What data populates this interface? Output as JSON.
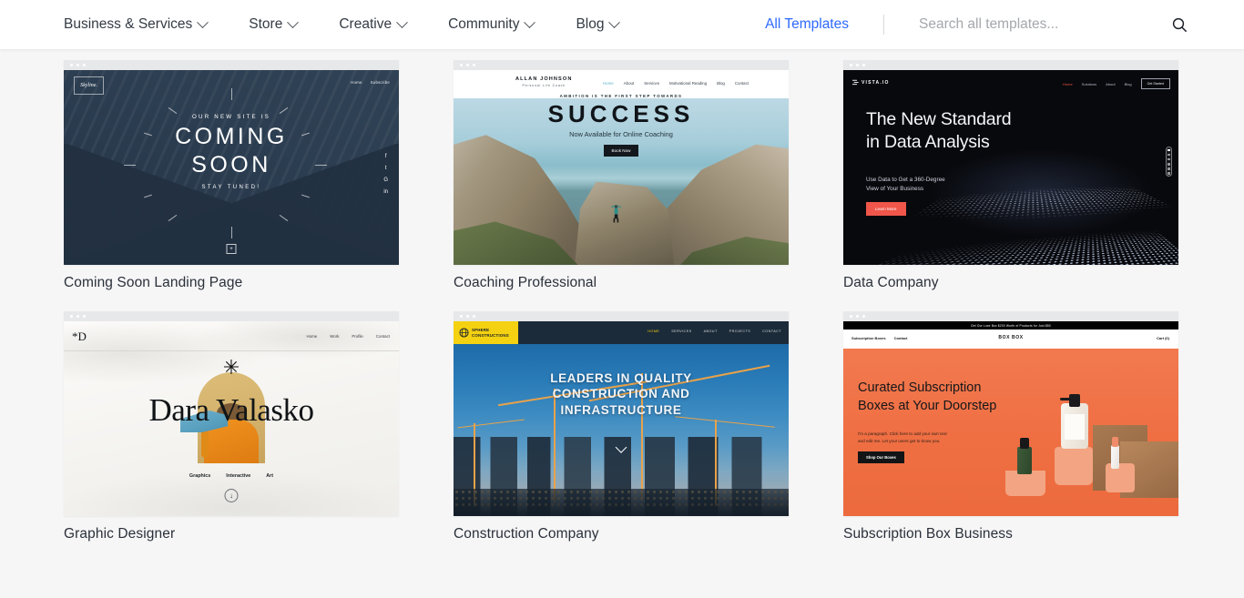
{
  "header": {
    "nav": [
      {
        "label": "Business & Services",
        "has_dropdown": true
      },
      {
        "label": "Store",
        "has_dropdown": true
      },
      {
        "label": "Creative",
        "has_dropdown": true
      },
      {
        "label": "Community",
        "has_dropdown": true
      },
      {
        "label": "Blog",
        "has_dropdown": true
      }
    ],
    "all_templates_label": "All Templates",
    "search": {
      "placeholder": "Search all templates...",
      "value": "",
      "icon": "search-icon"
    },
    "link_color": "#2e69ff"
  },
  "cards": [
    {
      "title": "Coming Soon Landing Page",
      "preview": {
        "logo": "Skyline.",
        "nav": [
          "Home",
          "Subscribe"
        ],
        "pre_heading": "OUR NEW SITE IS",
        "heading_line1": "COMING",
        "heading_line2": "SOON",
        "post_heading": "STAY TUNED!",
        "social": [
          "f",
          "t",
          "G",
          "in"
        ],
        "bg_color": "#2b3c4d"
      }
    },
    {
      "title": "Coaching Professional",
      "preview": {
        "brand_name": "ALLAN JOHNSON",
        "brand_tagline": "Personal Life Coach",
        "nav": [
          "Home",
          "About",
          "Services",
          "Motivational Reading",
          "Blog",
          "Contact"
        ],
        "active_nav": "Home",
        "pre_heading": "AMBITION IS THE FIRST STEP TOWARDS",
        "heading": "SUCCESS",
        "subheading": "Now Available for Online Coaching",
        "button": "Book Now",
        "accent_color": "#5fb7c9"
      }
    },
    {
      "title": "Data Company",
      "preview": {
        "logo": "VISTA.IO",
        "nav": [
          "Home",
          "Solutions",
          "About",
          "Blog"
        ],
        "active_nav": "Home",
        "cta": "Get Started",
        "heading_line1": "The New Standard",
        "heading_line2": "in Data Analysis",
        "paragraph_line1": "Use Data to Get a 360-Degree",
        "paragraph_line2": "View of Your Business",
        "button": "Learn More",
        "bg_color": "#08090d",
        "accent_color": "#f0564a"
      }
    },
    {
      "title": "Graphic Designer",
      "preview": {
        "logo": "*D",
        "nav": [
          "Home",
          "Work",
          "Profile",
          "Contact"
        ],
        "heading": "Dara Valasko",
        "tags": [
          "Graphics",
          "Interactive",
          "Art"
        ],
        "scroll_icon": "down-arrow-icon",
        "bg_color": "#fbfaf8"
      }
    },
    {
      "title": "Construction Company",
      "preview": {
        "logo_line1": "SPHERE",
        "logo_line2": "CONSTRUCTIONS",
        "nav": [
          "HOME",
          "SERVICES",
          "ABOUT",
          "PROJECTS",
          "CONTACT"
        ],
        "active_nav": "HOME",
        "heading_line1": "LEADERS IN QUALITY",
        "heading_line2": "CONSTRUCTION AND",
        "heading_line3": "INFRASTRUCTURE",
        "accent_color": "#f4d111",
        "bar_color": "#1c2b39"
      }
    },
    {
      "title": "Subscription Box Business",
      "preview": {
        "promo": "Get Our Luxe Box $200 Worth of Products for Just $80",
        "nav_left": [
          "Subscription Boxes",
          "Contact"
        ],
        "logo": "BOX BOX",
        "cart": "Cart (0)",
        "heading_line1": "Curated Subscription",
        "heading_line2": "Boxes at Your Doorstep",
        "paragraph_line1": "I'm a paragraph. Click here to add your own text",
        "paragraph_line2": "and edit me. Let your users get to know you.",
        "button": "Shop Our Boxes",
        "bg_color": "#f1744a"
      }
    }
  ]
}
